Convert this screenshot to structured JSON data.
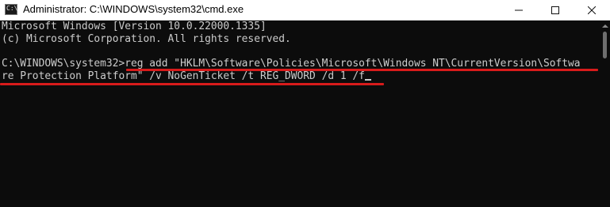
{
  "window": {
    "title": "Administrator: C:\\WINDOWS\\system32\\cmd.exe",
    "app_icon": "cmd-icon",
    "app_icon_glyph": "C:\\",
    "controls": {
      "minimize_icon": "minimize-icon",
      "maximize_icon": "maximize-icon",
      "close_icon": "close-icon"
    }
  },
  "console": {
    "version_line": "Microsoft Windows [Version 10.0.22000.1335]",
    "copyright_line": "(c) Microsoft Corporation. All rights reserved.",
    "prompt": "C:\\WINDOWS\\system32>",
    "command_part1": "reg add \"HKLM\\Software\\Policies\\Microsoft\\Windows NT\\CurrentVersion\\Softwa",
    "command_part2": "re Protection Platform\" /v NoGenTicket /t REG_DWORD /d 1 /f"
  },
  "colors": {
    "console_background": "#0c0c0c",
    "console_text": "#cccccc",
    "annotation_underline": "#d81b1b",
    "titlebar_background": "#ffffff"
  }
}
